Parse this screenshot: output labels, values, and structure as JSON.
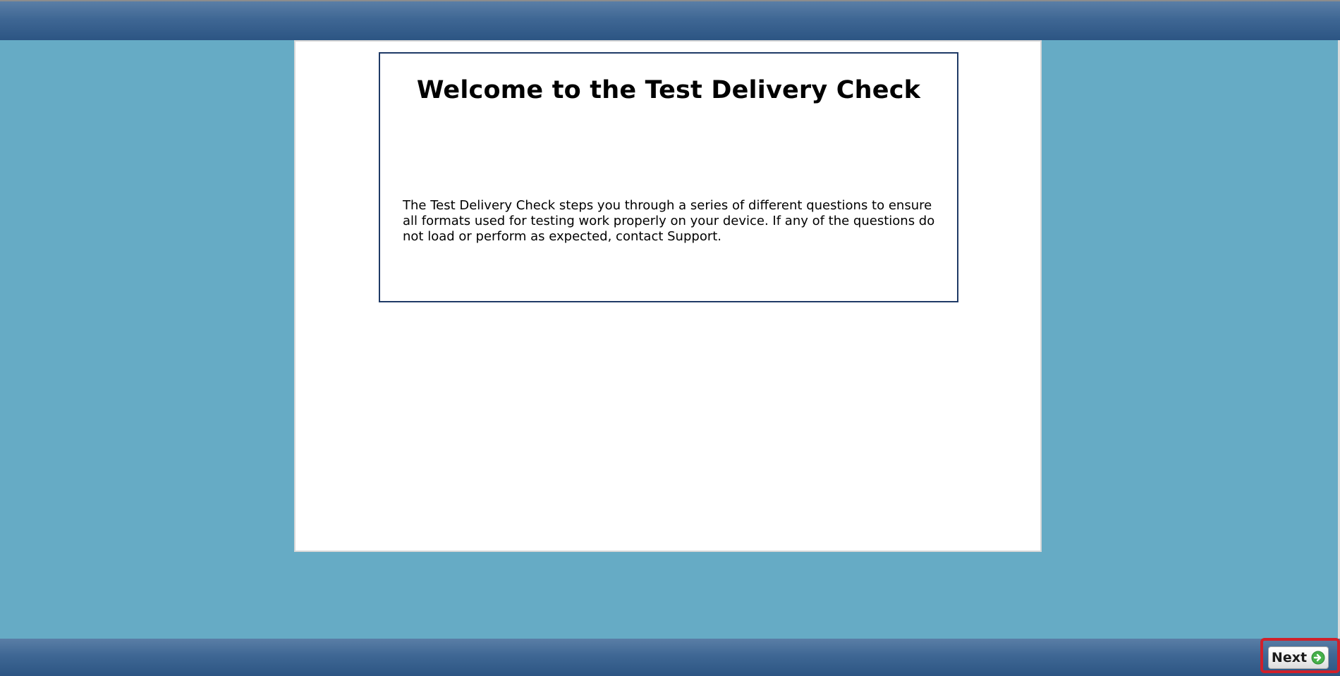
{
  "welcome": {
    "title": "Welcome to the Test Delivery Check",
    "body": "The Test Delivery Check steps you through a series of different questions to ensure all formats used for testing work properly on your device. If any of the questions do not load or perform as expected, contact Support."
  },
  "footer": {
    "next_label": "Next",
    "next_icon": "arrow-right-circle-icon"
  },
  "colors": {
    "background": "#66abc5",
    "bar": "#3f6794",
    "box_border": "#1f3a66",
    "highlight": "#d0202a",
    "next_icon": "#46b04a"
  }
}
